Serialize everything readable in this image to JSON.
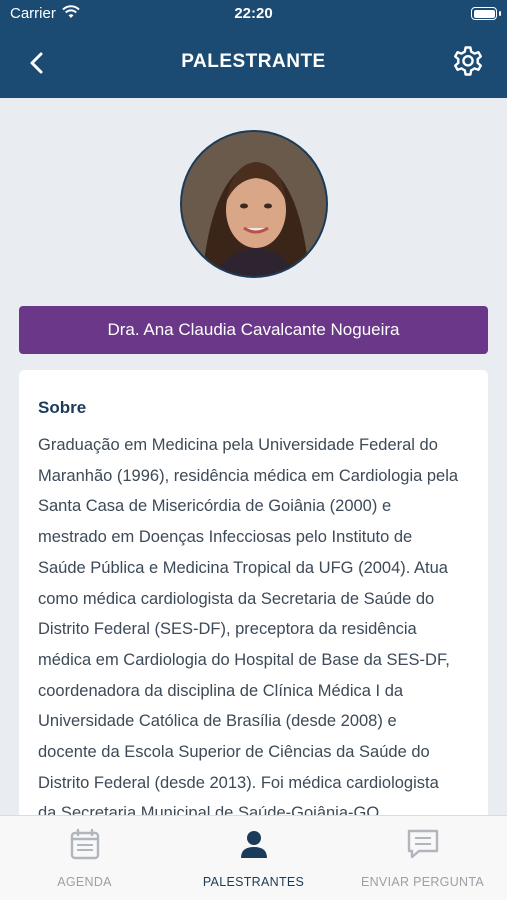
{
  "status_bar": {
    "carrier": "Carrier",
    "time": "22:20"
  },
  "header": {
    "title": "PALESTRANTE",
    "back_icon": "chevron-left-icon",
    "settings_icon": "gear-icon"
  },
  "speaker": {
    "name": "Dra. Ana Claudia Cavalcante Nogueira"
  },
  "about": {
    "title": "Sobre",
    "lines": [
      "Graduação em Medicina pela Universidade Federal do",
      "Maranhão (1996), residência médica em Cardiologia pela",
      "Santa Casa de Misericórdia de Goiânia (2000) e",
      "mestrado em Doenças Infecciosas pelo Instituto de",
      "Saúde Pública e Medicina Tropical da UFG (2004). Atua",
      "como médica cardiologista da Secretaria de Saúde do",
      "Distrito Federal (SES-DF), preceptora da residência",
      "médica em Cardiologia do Hospital de Base da SES-DF,",
      "coordenadora da disciplina de Clínica Médica I da",
      "Universidade Católica de Brasília (desde 2008) e",
      "docente da Escola Superior de Ciências da Saúde do",
      "Distrito Federal (desde 2013). Foi médica cardiologista",
      "da Secretaria Municipal de Saúde-Goiânia-GO"
    ]
  },
  "tabs": [
    {
      "label": "AGENDA",
      "icon": "calendar-icon",
      "active": false
    },
    {
      "label": "PALESTRANTES",
      "icon": "person-icon",
      "active": true
    },
    {
      "label": "ENVIAR PERGUNTA",
      "icon": "message-icon",
      "active": false
    }
  ],
  "colors": {
    "header": "#1b4a72",
    "banner": "#6b3788",
    "title_text": "#1b3b5a",
    "tab_inactive": "#9aa0a6"
  }
}
